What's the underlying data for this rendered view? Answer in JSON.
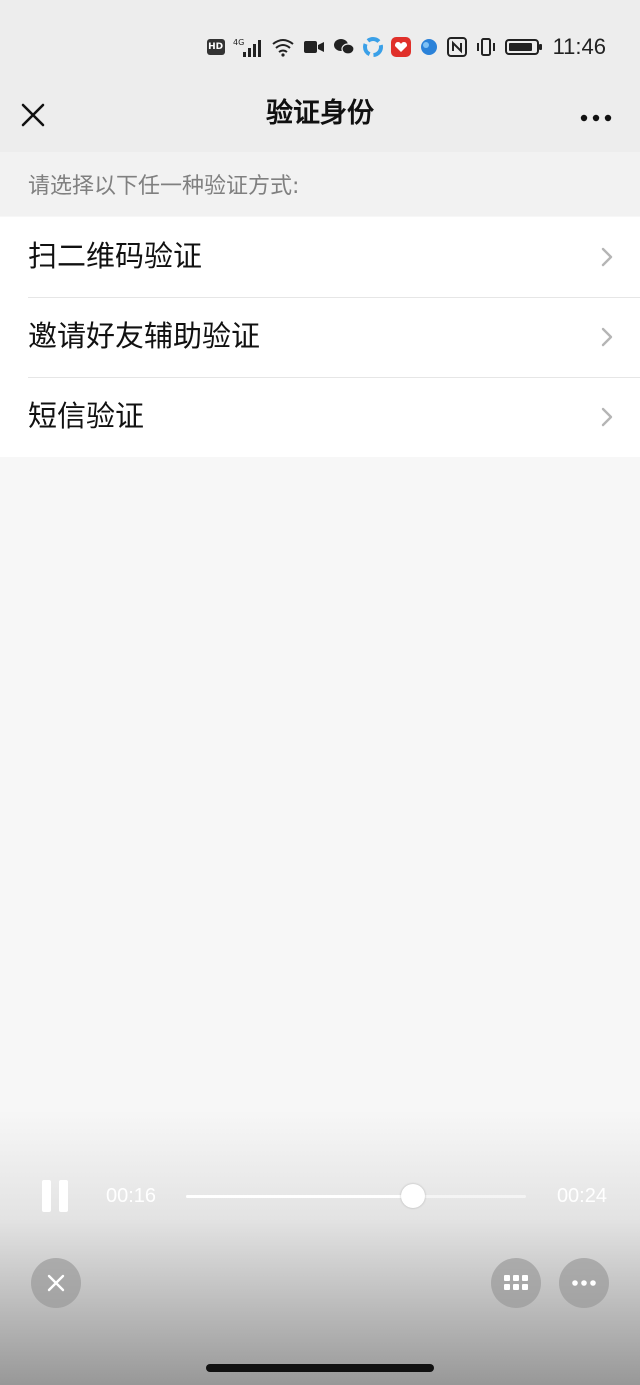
{
  "status_bar": {
    "time": "11:46",
    "hd_label": "HD",
    "network_label": "4G",
    "battery_level": 0.9,
    "icons": [
      "hd-icon",
      "signal-icon",
      "wifi-icon",
      "video-icon",
      "wechat-icon",
      "app-icon",
      "app-icon",
      "app-icon",
      "nfc-icon",
      "vibrate-icon",
      "battery-icon"
    ],
    "app_colors": [
      "#3aa0e8",
      "#e0302a",
      "#2b82d9"
    ]
  },
  "nav": {
    "title": "验证身份",
    "close_icon": "close-icon",
    "more_icon": "more-icon"
  },
  "hint": {
    "text": "请选择以下任一种验证方式:"
  },
  "options": [
    {
      "label": "扫二维码验证"
    },
    {
      "label": "邀请好友辅助验证"
    },
    {
      "label": "短信验证"
    }
  ],
  "media": {
    "current_time": "00:16",
    "total_time": "00:24",
    "progress": 0.6667,
    "buttons": [
      "pause-icon",
      "close-icon",
      "grid-icon",
      "more-icon"
    ]
  }
}
